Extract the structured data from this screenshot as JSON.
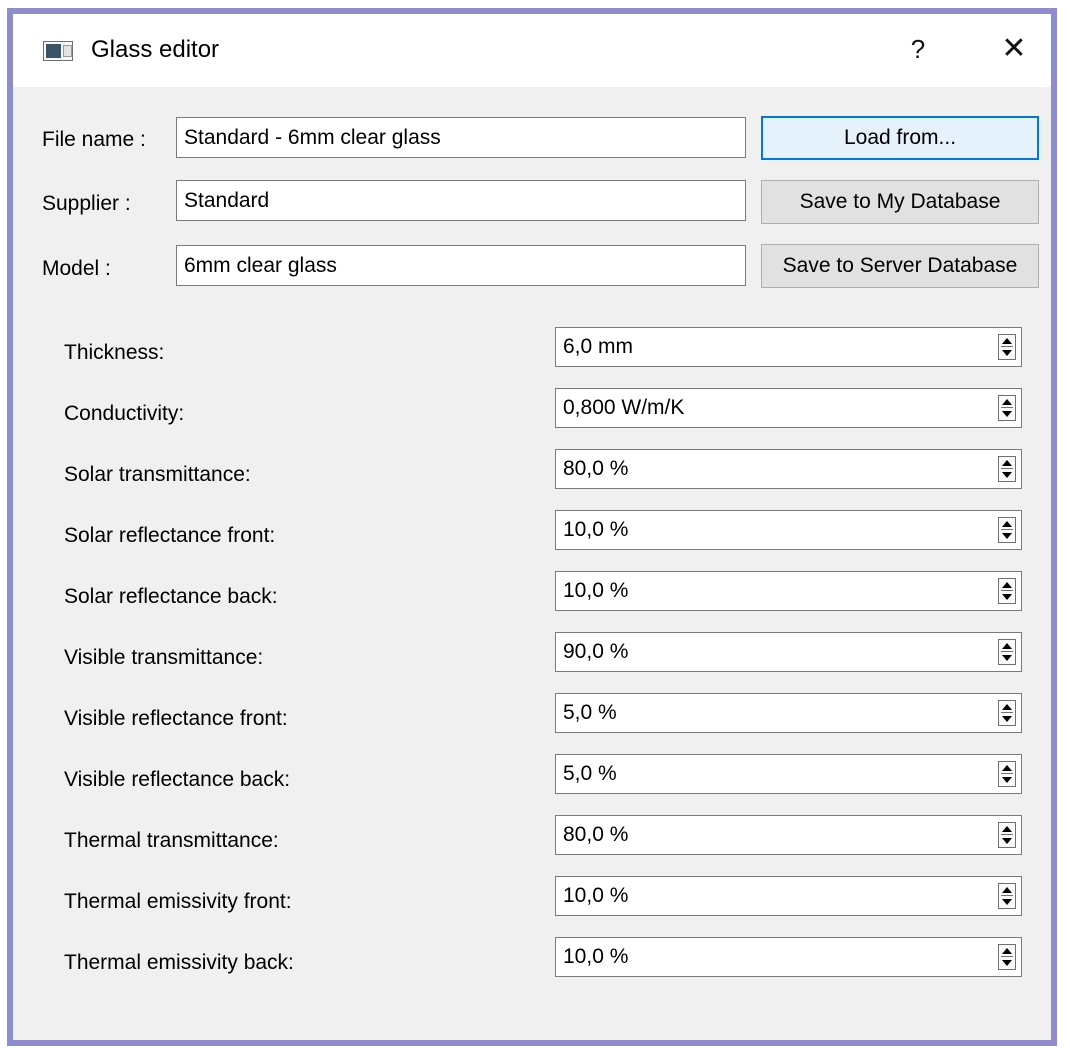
{
  "window": {
    "title": "Glass editor",
    "help_label": "?",
    "close_label": "✕"
  },
  "header_fields": {
    "file_name": {
      "label": "File name :",
      "value": "Standard - 6mm clear glass"
    },
    "supplier": {
      "label": "Supplier :",
      "value": "Standard"
    },
    "model": {
      "label": "Model :",
      "value": "6mm clear glass"
    }
  },
  "buttons": {
    "load_from": "Load from...",
    "save_my_db": "Save to My Database",
    "save_server_db": "Save to Server Database"
  },
  "properties": [
    {
      "label": "Thickness:",
      "value": "6,0 mm"
    },
    {
      "label": "Conductivity:",
      "value": "0,800 W/m/K"
    },
    {
      "label": "Solar transmittance:",
      "value": "80,0 %"
    },
    {
      "label": "Solar reflectance front:",
      "value": "10,0 %"
    },
    {
      "label": "Solar reflectance back:",
      "value": "10,0 %"
    },
    {
      "label": "Visible transmittance:",
      "value": "90,0 %"
    },
    {
      "label": "Visible reflectance front:",
      "value": "5,0 %"
    },
    {
      "label": "Visible reflectance back:",
      "value": "5,0 %"
    },
    {
      "label": "Thermal transmittance:",
      "value": "80,0 %"
    },
    {
      "label": "Thermal emissivity front:",
      "value": "10,0 %"
    },
    {
      "label": "Thermal emissivity back:",
      "value": "10,0 %"
    }
  ],
  "colors": {
    "window_border": "#8e8ccf",
    "dialog_bg": "#f0f0f0",
    "focus_accent": "#0078d7"
  },
  "icons": {
    "app": "glass-window-icon",
    "help": "question-mark",
    "close": "close-x",
    "spin": "up-down-arrows"
  }
}
